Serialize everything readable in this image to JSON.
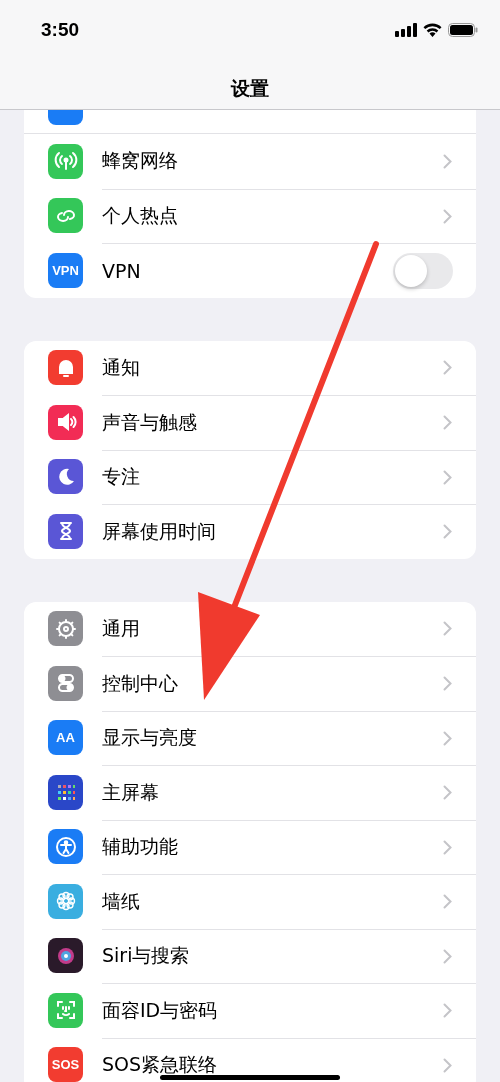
{
  "status_bar": {
    "time": "3:50"
  },
  "navigation": {
    "title": "设置"
  },
  "groups": [
    {
      "rows": [
        {
          "label": "",
          "kind": "cut",
          "color": "#1a7cf5"
        },
        {
          "label": "蜂窝网络",
          "kind": "chevron",
          "color": "#34c759"
        },
        {
          "label": "个人热点",
          "kind": "chevron",
          "color": "#34c759"
        },
        {
          "label": "VPN",
          "kind": "toggle",
          "color": "#1a7cf5",
          "icon_text": "VPN",
          "on": false
        }
      ]
    },
    {
      "rows": [
        {
          "label": "通知",
          "kind": "chevron",
          "color": "#f23c30"
        },
        {
          "label": "声音与触感",
          "kind": "chevron",
          "color": "#f22c55"
        },
        {
          "label": "专注",
          "kind": "chevron",
          "color": "#5a56d6"
        },
        {
          "label": "屏幕使用时间",
          "kind": "chevron",
          "color": "#5a56d6"
        }
      ]
    },
    {
      "rows": [
        {
          "label": "通用",
          "kind": "chevron",
          "color": "#8e8e93"
        },
        {
          "label": "控制中心",
          "kind": "chevron",
          "color": "#8e8e93"
        },
        {
          "label": "显示与亮度",
          "kind": "chevron",
          "color": "#1a7cf5",
          "icon_text": "AA"
        },
        {
          "label": "主屏幕",
          "kind": "chevron",
          "color": "#2a47c8"
        },
        {
          "label": "辅助功能",
          "kind": "chevron",
          "color": "#1a7cf5"
        },
        {
          "label": "墙纸",
          "kind": "chevron",
          "color": "#3aaee0"
        },
        {
          "label": "Siri与搜索",
          "kind": "chevron",
          "color": "#2a1a2a"
        },
        {
          "label": "面容ID与密码",
          "kind": "chevron",
          "color": "#34c759"
        },
        {
          "label": "SOS紧急联络",
          "kind": "chevron",
          "color": "#f23c30",
          "icon_text": "SOS"
        }
      ]
    }
  ]
}
